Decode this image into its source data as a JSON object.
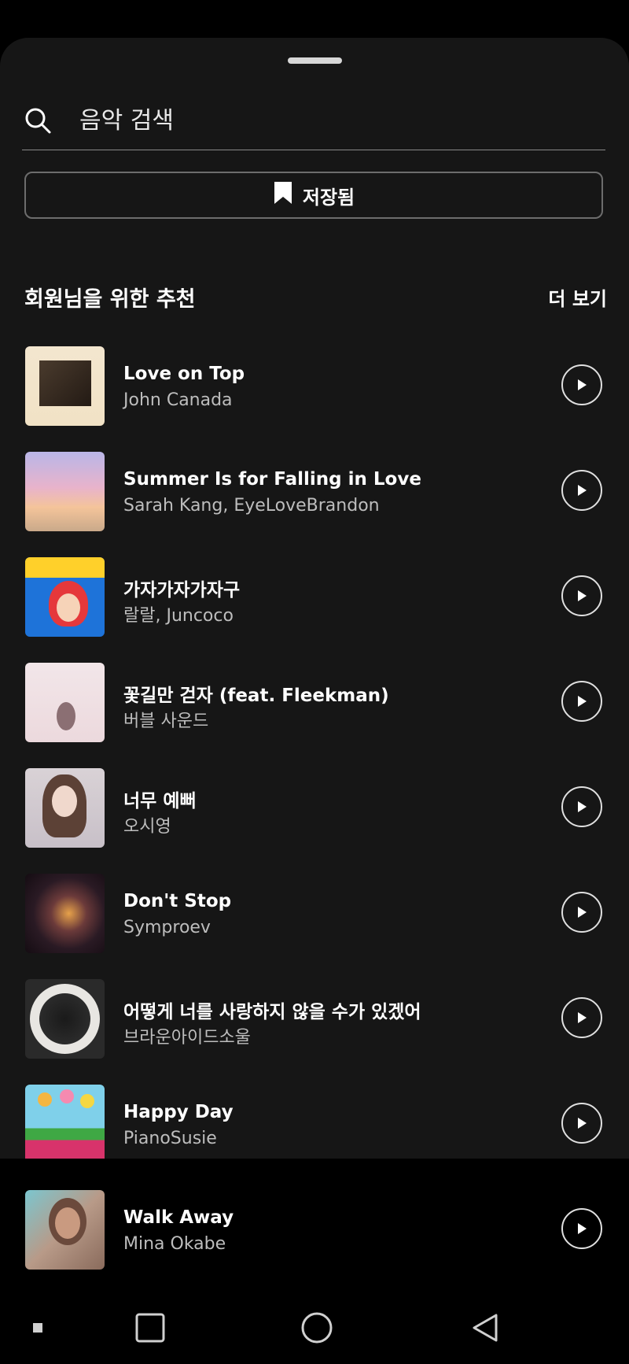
{
  "search": {
    "placeholder": "음악 검색",
    "value": ""
  },
  "saved_button": {
    "label": "저장됨",
    "icon": "bookmark-icon"
  },
  "recommendations": {
    "title": "회원님을 위한 추천",
    "see_more_label": "더 보기",
    "tracks": [
      {
        "title": "Love on Top",
        "artist": "John Canada"
      },
      {
        "title": "Summer Is for Falling in Love",
        "artist": "Sarah Kang, EyeLoveBrandon"
      },
      {
        "title": "가자가자가자구",
        "artist": "랄랄, Juncoco"
      },
      {
        "title": "꽃길만 걷자 (feat. Fleekman)",
        "artist": "버블 사운드"
      },
      {
        "title": "너무 예뻐",
        "artist": "오시영"
      },
      {
        "title": "Don't Stop",
        "artist": "Symproev"
      },
      {
        "title": "어떻게 너를 사랑하지 않을 수가 있겠어",
        "artist": "브라운아이드소울"
      },
      {
        "title": "Happy Day",
        "artist": "PianoSusie"
      },
      {
        "title": "Walk Away",
        "artist": "Mina Okabe"
      }
    ]
  },
  "colors": {
    "sheet_background": "#161616",
    "screen_background": "#000000",
    "primary_text": "#ffffff",
    "secondary_text": "#bdbdbd",
    "divider": "#8a8a8a"
  },
  "nav_bar": {
    "icons": [
      "recent-dot-icon",
      "square-icon",
      "home-circle-icon",
      "back-triangle-icon"
    ]
  }
}
